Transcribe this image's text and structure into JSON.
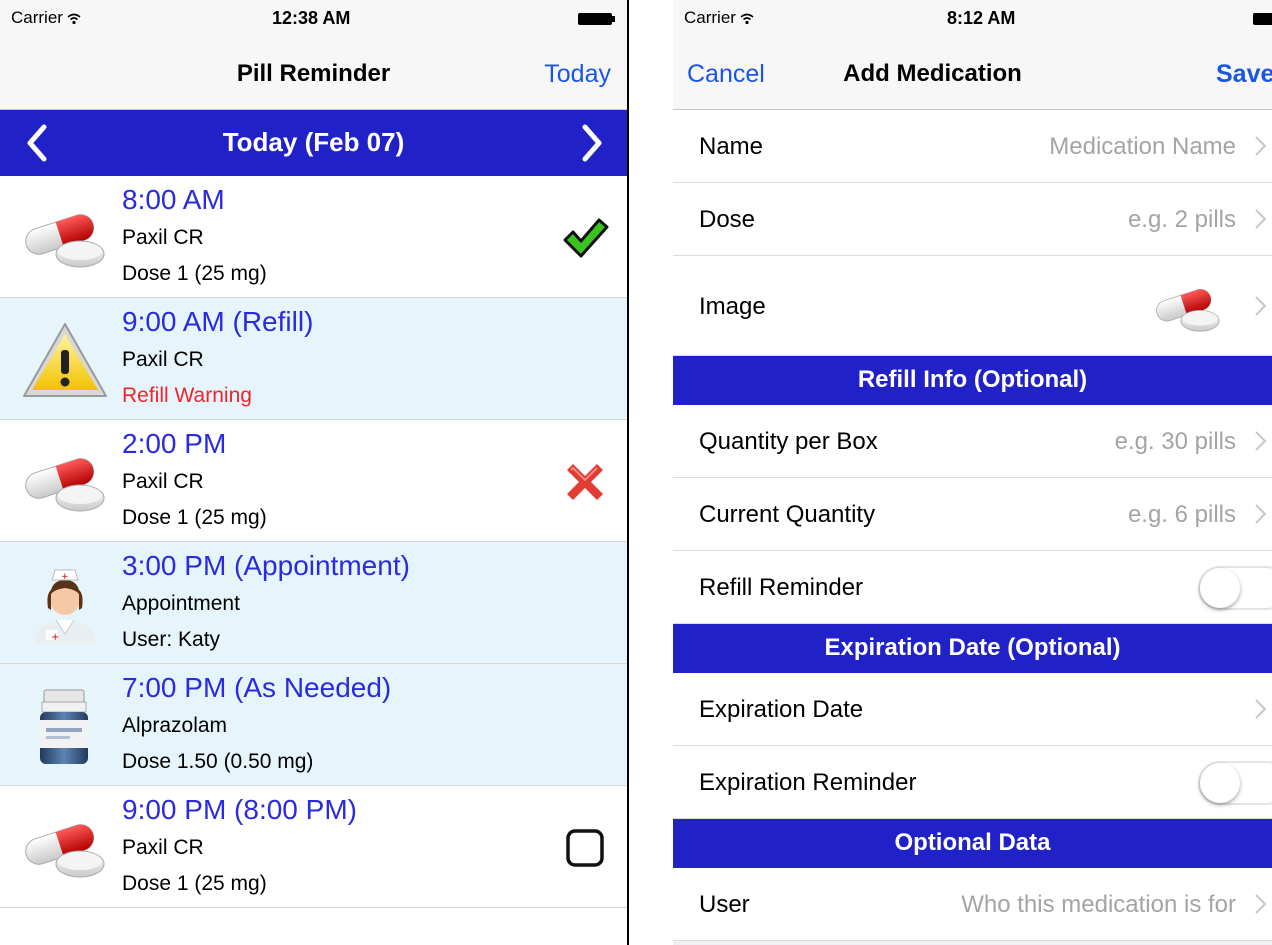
{
  "left": {
    "status": {
      "carrier": "Carrier",
      "time": "12:38 AM"
    },
    "nav": {
      "title": "Pill Reminder",
      "right_button": "Today"
    },
    "date_bar": {
      "label": "Today (Feb 07)"
    },
    "rows": [
      {
        "time": "8:00 AM",
        "name": "Paxil CR",
        "detail": "Dose 1 (25 mg)",
        "icon": "pill-icon",
        "status": "taken-checkmark-icon"
      },
      {
        "time": "9:00 AM (Refill)",
        "name": "Paxil CR",
        "detail": "Refill Warning",
        "icon": "warning-icon",
        "status": ""
      },
      {
        "time": "2:00 PM",
        "name": "Paxil CR",
        "detail": "Dose 1 (25 mg)",
        "icon": "pill-icon",
        "status": "missed-x-icon"
      },
      {
        "time": "3:00 PM (Appointment)",
        "name": "Appointment",
        "detail": "User: Katy",
        "icon": "nurse-icon",
        "status": ""
      },
      {
        "time": "7:00 PM (As Needed)",
        "name": "Alprazolam",
        "detail": "Dose 1.50 (0.50 mg)",
        "icon": "pill-bottle-icon",
        "status": ""
      },
      {
        "time": "9:00 PM (8:00 PM)",
        "name": "Paxil CR",
        "detail": "Dose 1 (25 mg)",
        "icon": "pill-icon",
        "status": "unchecked-box-icon"
      }
    ]
  },
  "right": {
    "status": {
      "carrier": "Carrier",
      "time": "8:12 AM"
    },
    "nav": {
      "left_button": "Cancel",
      "title": "Add Medication",
      "right_button": "Save"
    },
    "fields": {
      "name": {
        "label": "Name",
        "placeholder": "Medication Name"
      },
      "dose": {
        "label": "Dose",
        "placeholder": "e.g. 2 pills"
      },
      "image": {
        "label": "Image"
      }
    },
    "sections": {
      "refill": "Refill Info (Optional)",
      "expiration": "Expiration Date (Optional)",
      "optional": "Optional Data"
    },
    "refill_fields": {
      "quantity_per_box": {
        "label": "Quantity per Box",
        "placeholder": "e.g. 30 pills"
      },
      "current_quantity": {
        "label": "Current Quantity",
        "placeholder": "e.g. 6 pills"
      },
      "refill_reminder": {
        "label": "Refill Reminder",
        "on": false
      }
    },
    "expiration_fields": {
      "expiration_date": {
        "label": "Expiration Date"
      },
      "expiration_reminder": {
        "label": "Expiration Reminder",
        "on": false
      }
    },
    "optional_fields": {
      "user": {
        "label": "User",
        "placeholder": "Who this medication is for"
      }
    }
  },
  "colors": {
    "accent_blue": "#1a55e8",
    "header_blue": "#2121c8",
    "time_blue": "#2a2ae0",
    "warning_red": "#f2232a",
    "alt_row": "#e6f5fb",
    "placeholder_gray": "#a4a4a8"
  }
}
